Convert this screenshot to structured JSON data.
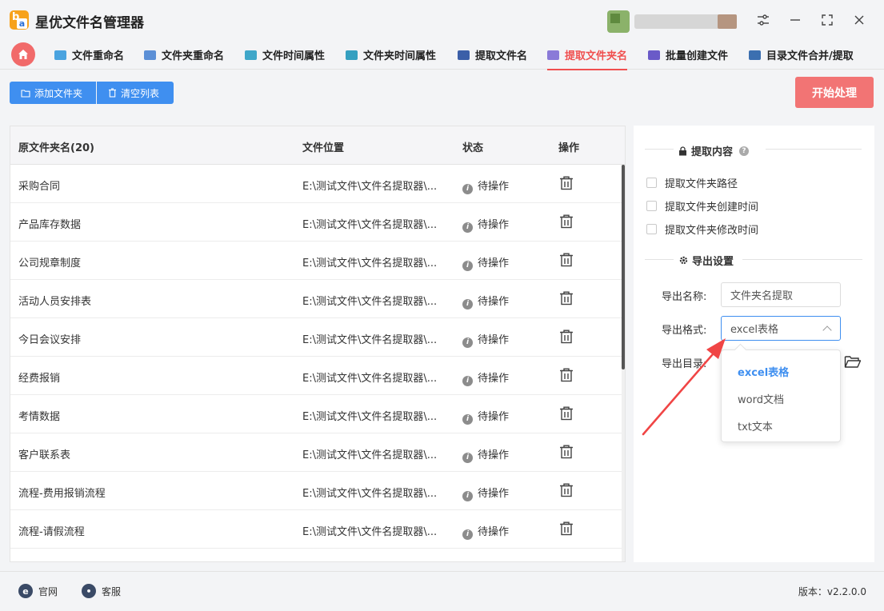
{
  "app": {
    "title": "星优文件名管理器"
  },
  "tabs": [
    {
      "label": "文件重命名",
      "color": "#4aa3df"
    },
    {
      "label": "文件夹重命名",
      "color": "#5b8fd6"
    },
    {
      "label": "文件时间属性",
      "color": "#3fa7c9"
    },
    {
      "label": "文件夹时间属性",
      "color": "#35a0c0"
    },
    {
      "label": "提取文件名",
      "color": "#3b5fa8"
    },
    {
      "label": "提取文件夹名",
      "color": "#8a7ad8"
    },
    {
      "label": "批量创建文件",
      "color": "#6a5ac8"
    },
    {
      "label": "目录文件合并/提取",
      "color": "#3b6fb0"
    }
  ],
  "toolbar": {
    "add_folder": "添加文件夹",
    "clear_list": "清空列表",
    "start": "开始处理"
  },
  "table": {
    "headers": {
      "name": "原文件夹名(20)",
      "location": "文件位置",
      "status": "状态",
      "action": "操作"
    },
    "rows": [
      {
        "name": "采购合同",
        "location": "E:\\测试文件\\文件名提取器\\...",
        "status": "待操作"
      },
      {
        "name": "产品库存数据",
        "location": "E:\\测试文件\\文件名提取器\\...",
        "status": "待操作"
      },
      {
        "name": "公司规章制度",
        "location": "E:\\测试文件\\文件名提取器\\...",
        "status": "待操作"
      },
      {
        "name": "活动人员安排表",
        "location": "E:\\测试文件\\文件名提取器\\...",
        "status": "待操作"
      },
      {
        "name": "今日会议安排",
        "location": "E:\\测试文件\\文件名提取器\\...",
        "status": "待操作"
      },
      {
        "name": "经费报销",
        "location": "E:\\测试文件\\文件名提取器\\...",
        "status": "待操作"
      },
      {
        "name": "考情数据",
        "location": "E:\\测试文件\\文件名提取器\\...",
        "status": "待操作"
      },
      {
        "name": "客户联系表",
        "location": "E:\\测试文件\\文件名提取器\\...",
        "status": "待操作"
      },
      {
        "name": "流程-费用报销流程",
        "location": "E:\\测试文件\\文件名提取器\\...",
        "status": "待操作"
      },
      {
        "name": "流程-请假流程",
        "location": "E:\\测试文件\\文件名提取器\\...",
        "status": "待操作"
      }
    ]
  },
  "side": {
    "extract_title": "提取内容",
    "options": [
      "提取文件夹路径",
      "提取文件夹创建时间",
      "提取文件夹修改时间"
    ],
    "export_title": "导出设置",
    "name_label": "导出名称:",
    "name_value": "文件夹名提取",
    "format_label": "导出格式:",
    "format_value": "excel表格",
    "dir_label": "导出目录:",
    "format_options": [
      "excel表格",
      "word文档",
      "txt文本"
    ]
  },
  "footer": {
    "website": "官网",
    "service": "客服",
    "version": "版本：v2.2.0.0"
  },
  "colors": {
    "accent": "#f04f4f",
    "primary": "#3f8ff0",
    "start": "#f27474",
    "arrow": "#f04545"
  }
}
